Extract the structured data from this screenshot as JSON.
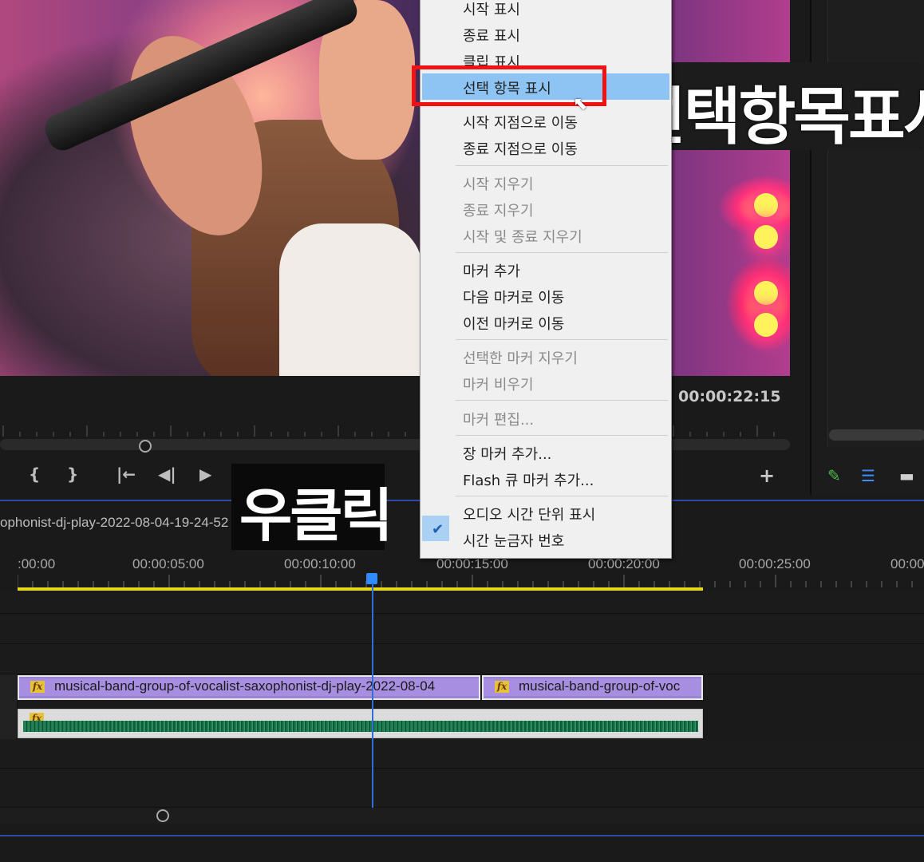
{
  "monitor": {
    "timecode": "00:00:22:15",
    "controls": [
      "{",
      "}",
      "|←",
      "◀|",
      "▶",
      "+"
    ]
  },
  "timeline": {
    "sequence_name": "ophonist-dj-play-2022-08-04-19-24-52",
    "timecodes": [
      ":00:00",
      "00:00:05:00",
      "00:00:10:00",
      "00:00:15:00",
      "00:00:20:00",
      "00:00:25:00",
      "00:00"
    ],
    "clips": [
      {
        "label": "musical-band-group-of-vocalist-saxophonist-dj-play-2022-08-04"
      },
      {
        "label": "musical-band-group-of-voc"
      }
    ],
    "fx_badge": "fx"
  },
  "context_menu": {
    "items": [
      {
        "label": "시작 표시",
        "disabled": false
      },
      {
        "label": "종료 표시",
        "disabled": false
      },
      {
        "label": "클립 표시",
        "disabled": false
      },
      {
        "label": "선택 항목 표시",
        "disabled": false,
        "highlighted": true
      },
      {
        "label": "시작 지점으로 이동",
        "disabled": false
      },
      {
        "label": "종료 지점으로 이동",
        "disabled": false
      },
      {
        "label": "시작 지우기",
        "disabled": true
      },
      {
        "label": "종료 지우기",
        "disabled": true
      },
      {
        "label": "시작 및 종료 지우기",
        "disabled": true
      },
      {
        "label": "마커 추가",
        "disabled": false
      },
      {
        "label": "다음 마커로 이동",
        "disabled": false
      },
      {
        "label": "이전 마커로 이동",
        "disabled": false
      },
      {
        "label": "선택한 마커 지우기",
        "disabled": true
      },
      {
        "label": "마커 비우기",
        "disabled": true
      },
      {
        "label": "마커 편집...",
        "disabled": true
      },
      {
        "label": "장 마커 추가...",
        "disabled": false
      },
      {
        "label": "Flash 큐 마커 추가...",
        "disabled": false
      },
      {
        "label": "오디오 시간 단위 표시",
        "disabled": false
      },
      {
        "label": "시간 눈금자 번호",
        "disabled": false,
        "checked": true
      }
    ],
    "checkmark": "✔"
  },
  "annotations": {
    "title_caption": "선택항목표시",
    "right_click_caption": "우클릭"
  },
  "colors": {
    "highlight": "#8ec4f3",
    "annotation_box": "#f01313",
    "playhead": "#2f8bff",
    "work_area": "#e6d91c",
    "video_clip": "#a78ee0",
    "audio_wave": "#1f7a50"
  }
}
